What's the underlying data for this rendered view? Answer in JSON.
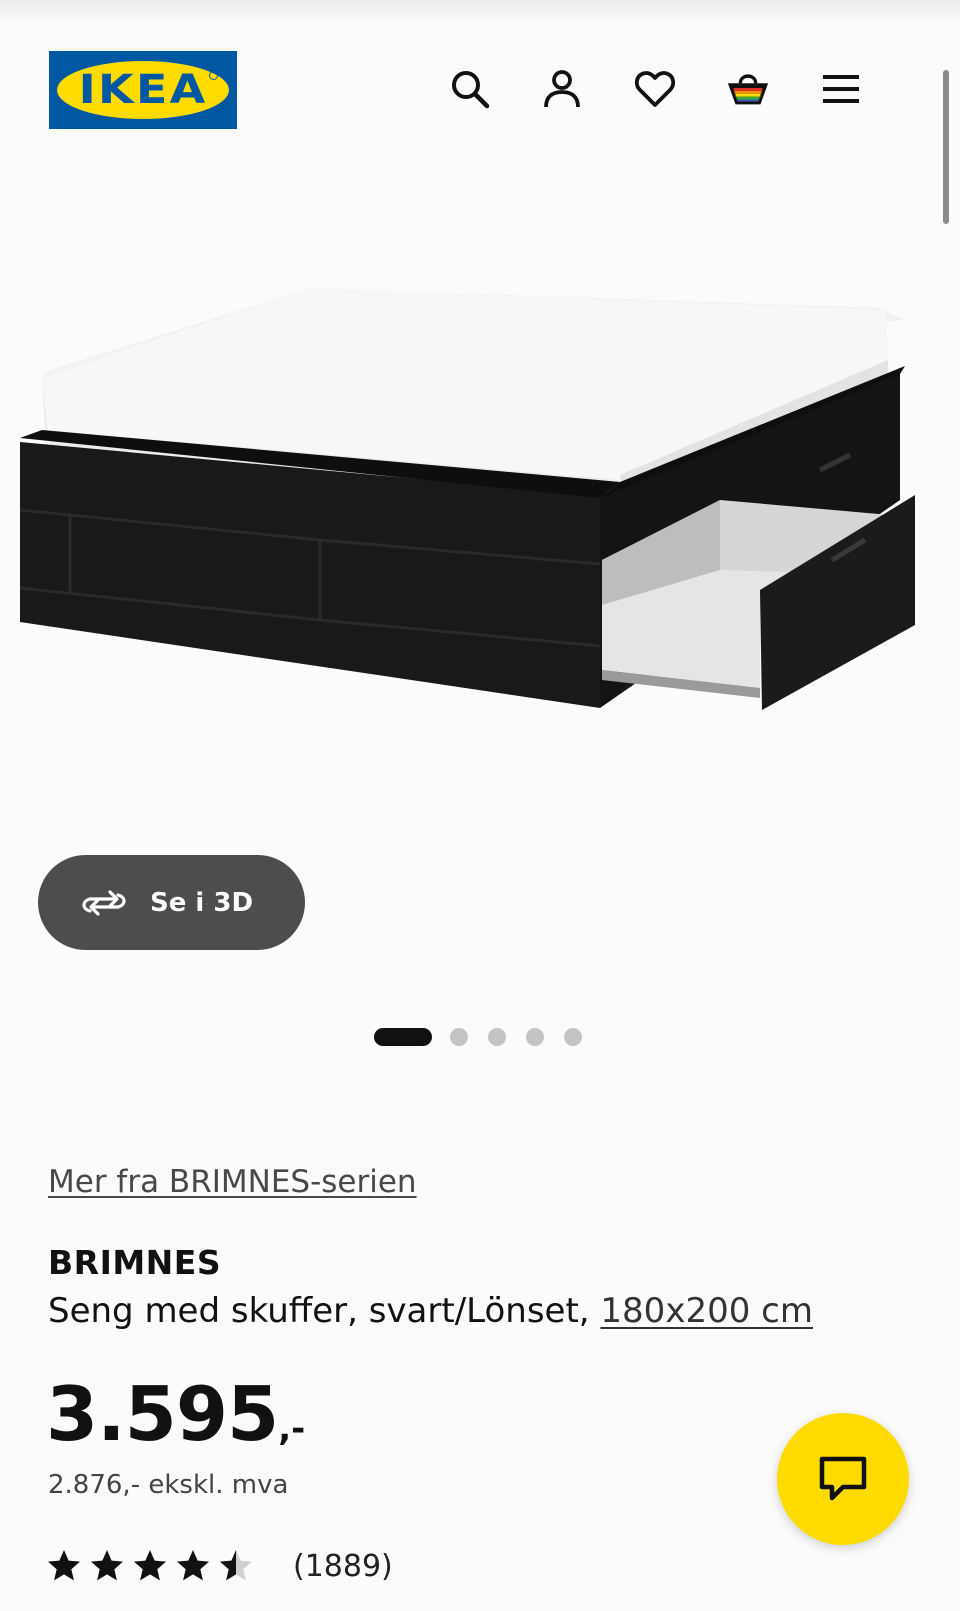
{
  "header": {
    "logo_text": "IKEA",
    "icons": [
      "search-icon",
      "account-icon",
      "heart-icon",
      "basket-icon",
      "menu-icon"
    ]
  },
  "gallery": {
    "view_3d_label": "Se i 3D",
    "dot_count": 5,
    "active_index": 0
  },
  "product": {
    "series_link": "Mer fra BRIMNES-serien",
    "name": "BRIMNES",
    "description": "Seng med skuffer, svart/Lönset, ",
    "size": "180x200 cm",
    "price_main": "3.595",
    "price_suffix": ",-",
    "price_ex_vat": "2.876,- ekskl. mva",
    "rating": 4.5,
    "review_count": "(1889)"
  },
  "colors": {
    "ikea_blue": "#0058a3",
    "ikea_yellow": "#ffdb00",
    "button_gray": "#4d4d4d"
  }
}
